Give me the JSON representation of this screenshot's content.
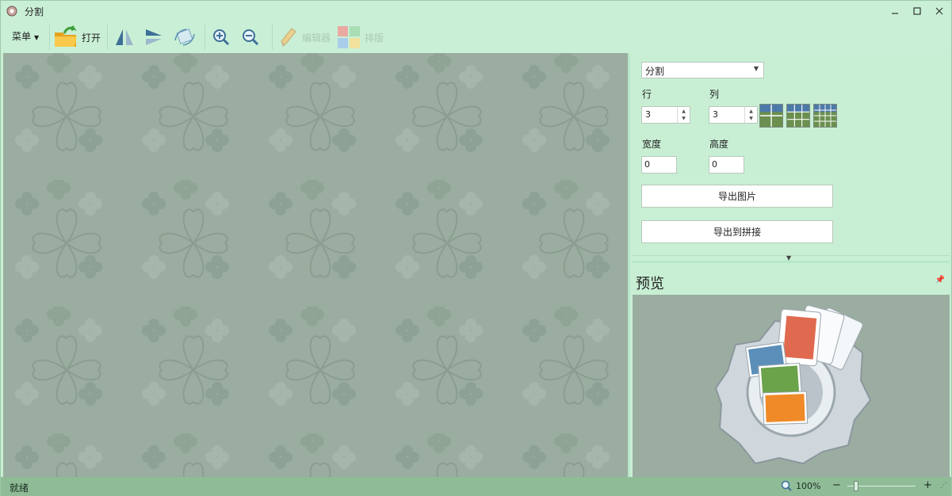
{
  "window": {
    "title": "分割"
  },
  "toolbar": {
    "menu_label": "菜单",
    "open_label": "打开",
    "editor_label": "编辑器",
    "layout_label": "排版"
  },
  "panel": {
    "mode_select": "分割",
    "rows_label": "行",
    "cols_label": "列",
    "rows_value": "3",
    "cols_value": "3",
    "width_label": "宽度",
    "height_label": "高度",
    "width_value": "0",
    "height_value": "0",
    "export_image_label": "导出图片",
    "export_to_collage_label": "导出到拼接",
    "preview_title": "预览"
  },
  "status": {
    "text": "就绪",
    "zoom": "100%",
    "zoom_level": 0.1
  },
  "colors": {
    "accent": "#c9f0d6",
    "canvas": "#9aada0",
    "statusbar": "#8fbc97"
  }
}
